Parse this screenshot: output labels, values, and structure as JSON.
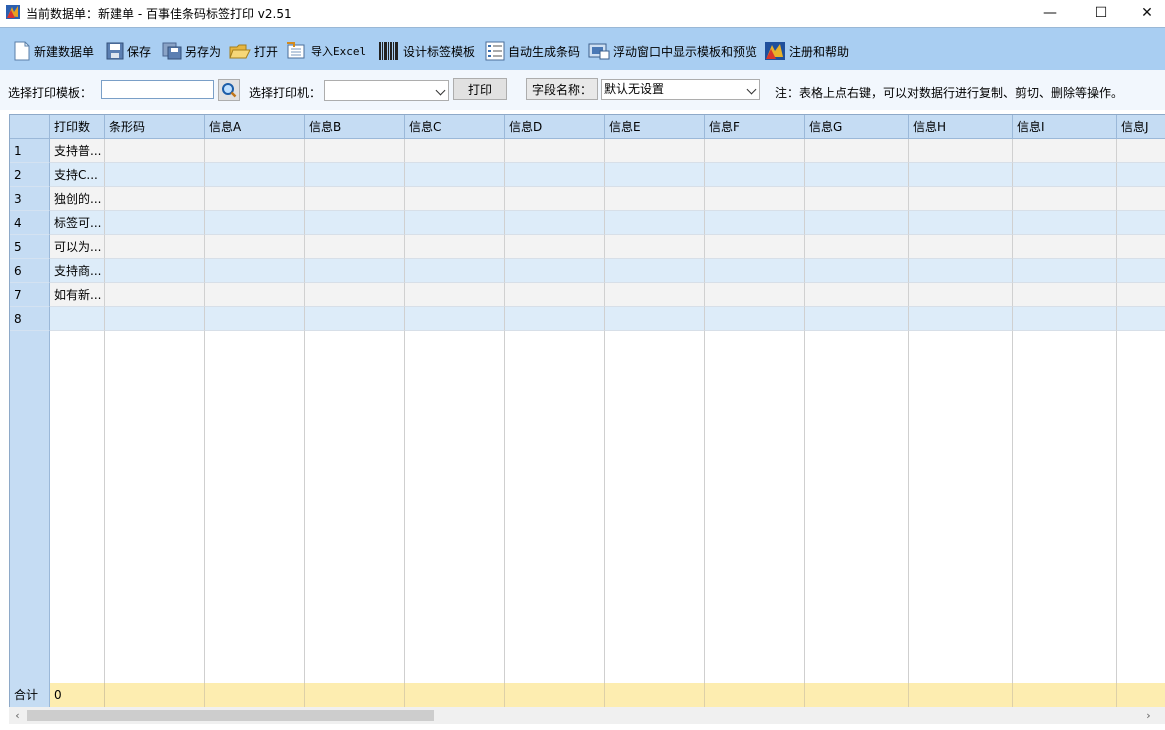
{
  "window": {
    "title": "当前数据单：新建单 - 百事佳条码标签打印 v2.51",
    "minimize": "—",
    "maximize": "☐",
    "close": "✕"
  },
  "toolbar": {
    "new": "新建数据单",
    "save": "保存",
    "save_as": "另存为",
    "open": "打开",
    "import_excel": "导入Excel",
    "design_template": "设计标签模板",
    "auto_barcode": "自动生成条码",
    "float_window": "浮动窗口中显示模板和预览",
    "register_help": "注册和帮助"
  },
  "params": {
    "template_label": "选择打印模板：",
    "template_value": "",
    "printer_label": "选择打印机：",
    "printer_value": "",
    "print_button": "打印",
    "field_name_label": "字段名称：",
    "field_name_value": "默认无设置",
    "note": "注：表格上点右键，可以对数据行进行复制、剪切、删除等操作。"
  },
  "grid": {
    "columns": [
      "打印数",
      "条形码",
      "信息A",
      "信息B",
      "信息C",
      "信息D",
      "信息E",
      "信息F",
      "信息G",
      "信息H",
      "信息I",
      "信息J"
    ],
    "rows": [
      {
        "num": "1",
        "cells": [
          "支持普...",
          "",
          "",
          "",
          "",
          "",
          "",
          "",
          "",
          "",
          "",
          ""
        ]
      },
      {
        "num": "2",
        "cells": [
          "支持C...",
          "",
          "",
          "",
          "",
          "",
          "",
          "",
          "",
          "",
          "",
          ""
        ]
      },
      {
        "num": "3",
        "cells": [
          "独创的...",
          "",
          "",
          "",
          "",
          "",
          "",
          "",
          "",
          "",
          "",
          ""
        ]
      },
      {
        "num": "4",
        "cells": [
          "标签可...",
          "",
          "",
          "",
          "",
          "",
          "",
          "",
          "",
          "",
          "",
          ""
        ]
      },
      {
        "num": "5",
        "cells": [
          "可以为...",
          "",
          "",
          "",
          "",
          "",
          "",
          "",
          "",
          "",
          "",
          ""
        ]
      },
      {
        "num": "6",
        "cells": [
          "支持商...",
          "",
          "",
          "",
          "",
          "",
          "",
          "",
          "",
          "",
          "",
          ""
        ]
      },
      {
        "num": "7",
        "cells": [
          "如有新...",
          "",
          "",
          "",
          "",
          "",
          "",
          "",
          "",
          "",
          "",
          ""
        ]
      },
      {
        "num": "8",
        "cells": [
          "",
          "",
          "",
          "",
          "",
          "",
          "",
          "",
          "",
          "",
          "",
          ""
        ]
      }
    ],
    "totals_label": "合计",
    "totals_value": "0"
  },
  "scrollbar": {
    "left_arrow": "‹",
    "right_arrow": "›"
  },
  "colors": {
    "toolbar": "#a9cef2",
    "header": "#c5dcf3",
    "row_alt": "#ddecf9",
    "row_even": "#f3f3f3",
    "totals": "#fdedb0"
  }
}
